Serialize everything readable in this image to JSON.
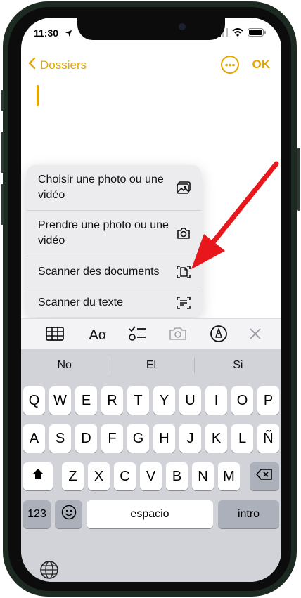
{
  "status": {
    "time": "11:30"
  },
  "nav": {
    "back_label": "Dossiers",
    "ok_label": "OK"
  },
  "menu": {
    "items": [
      {
        "label": "Choisir une photo ou une vidéo",
        "icon": "photo-library-icon"
      },
      {
        "label": "Prendre une photo ou une vidéo",
        "icon": "camera-icon"
      },
      {
        "label": "Scanner des documents",
        "icon": "document-scan-icon"
      },
      {
        "label": "Scanner du texte",
        "icon": "text-scan-icon"
      }
    ]
  },
  "toolbar": {
    "format_label": "Aα"
  },
  "keyboard": {
    "suggestions": [
      "No",
      "El",
      "Si"
    ],
    "row1": [
      "Q",
      "W",
      "E",
      "R",
      "T",
      "Y",
      "U",
      "I",
      "O",
      "P"
    ],
    "row2": [
      "A",
      "S",
      "D",
      "F",
      "G",
      "H",
      "J",
      "K",
      "L",
      "Ñ"
    ],
    "row3": [
      "Z",
      "X",
      "C",
      "V",
      "B",
      "N",
      "M"
    ],
    "numbers_label": "123",
    "space_label": "espacio",
    "return_label": "intro"
  },
  "colors": {
    "accent": "#e3a600",
    "arrow": "#e8171b",
    "keyboard_bg": "#d1d3d9"
  }
}
